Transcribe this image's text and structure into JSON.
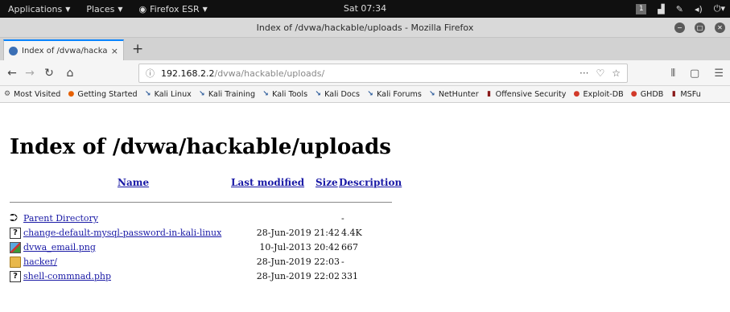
{
  "topbar": {
    "applications": "Applications",
    "places": "Places",
    "app_name": "Firefox ESR",
    "clock": "Sat 07:34",
    "workspace": "1"
  },
  "window": {
    "title": "Index of /dvwa/hackable/uploads - Mozilla Firefox"
  },
  "tab": {
    "label": "Index of /dvwa/hackable/",
    "close": "×",
    "new_tab": "+"
  },
  "nav": {
    "url_host": "192.168.2.2",
    "url_path": "/dvwa/hackable/uploads/",
    "more": "···"
  },
  "bookmarks": [
    {
      "label": "Most Visited",
      "icon": "gear-icon"
    },
    {
      "label": "Getting Started",
      "icon": "firefox-icon"
    },
    {
      "label": "Kali Linux",
      "icon": "kali-icon"
    },
    {
      "label": "Kali Training",
      "icon": "kali-icon"
    },
    {
      "label": "Kali Tools",
      "icon": "kali-icon"
    },
    {
      "label": "Kali Docs",
      "icon": "kali-icon"
    },
    {
      "label": "Kali Forums",
      "icon": "kali-icon"
    },
    {
      "label": "NetHunter",
      "icon": "kali-icon"
    },
    {
      "label": "Offensive Security",
      "icon": "offsec-icon"
    },
    {
      "label": "Exploit-DB",
      "icon": "exploitdb-icon"
    },
    {
      "label": "GHDB",
      "icon": "ghdb-icon"
    },
    {
      "label": "MSFu",
      "icon": "offsec-icon"
    }
  ],
  "page": {
    "heading": "Index of /dvwa/hackable/uploads",
    "columns": {
      "name": "Name",
      "last_modified": "Last modified",
      "size": "Size",
      "description": "Description"
    },
    "rows": [
      {
        "icon": "back-icon",
        "name": "Parent Directory",
        "modified": "",
        "size": "-"
      },
      {
        "icon": "unknown-file-icon",
        "name": "change-default-mysql-password-in-kali-linux",
        "modified": "28-Jun-2019 21:42",
        "size": "4.4K"
      },
      {
        "icon": "image-file-icon",
        "name": "dvwa_email.png",
        "modified": "10-Jul-2013 20:42",
        "size": "667"
      },
      {
        "icon": "folder-icon",
        "name": "hacker/",
        "modified": "28-Jun-2019 22:03",
        "size": "-"
      },
      {
        "icon": "unknown-file-icon",
        "name": "shell-commnad.php",
        "modified": "28-Jun-2019 22:02",
        "size": "331"
      }
    ]
  }
}
